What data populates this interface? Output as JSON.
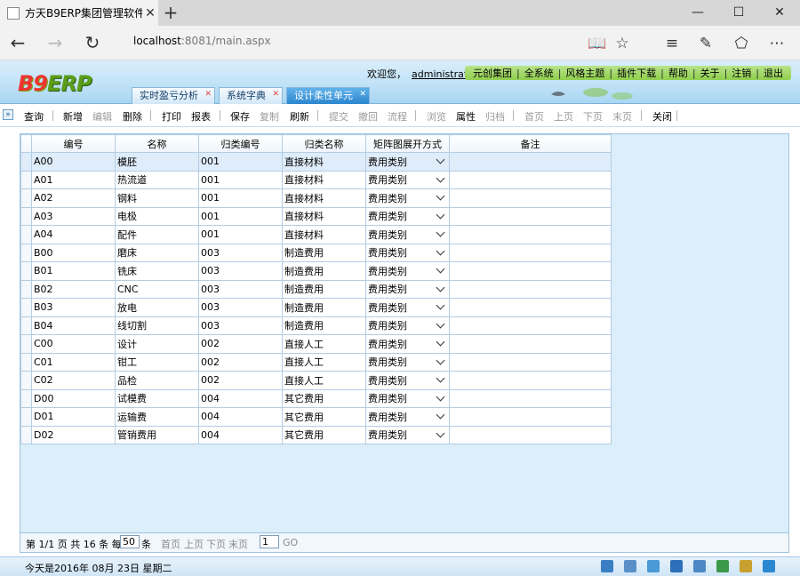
{
  "browser": {
    "tab_title": "方天B9ERP集团管理软件",
    "tab_close": "✕",
    "new_tab": "+",
    "minimize": "—",
    "maximize": "☐",
    "close": "✕",
    "url_host": "localhost",
    "url_rest": ":8081/main.aspx"
  },
  "app": {
    "logo_b9": "B9",
    "logo_erp": "ERP",
    "welcome": "欢迎您，",
    "user": "administrator",
    "top_menu": [
      "元创集团",
      "全系统",
      "风格主题",
      "插件下载",
      "帮助",
      "关于",
      "注销",
      "退出"
    ],
    "tabs": [
      {
        "label": "实时盈亏分析"
      },
      {
        "label": "系统字典"
      },
      {
        "label": "设计柔性单元",
        "active": true
      }
    ],
    "tab_close": "✕"
  },
  "toolbar": {
    "expand": "»",
    "groups": [
      [
        {
          "label": "查询",
          "enabled": true
        }
      ],
      [
        {
          "label": "新增",
          "enabled": true
        },
        {
          "label": "编辑",
          "enabled": false
        },
        {
          "label": "删除",
          "enabled": true
        }
      ],
      [
        {
          "label": "打印",
          "enabled": true
        },
        {
          "label": "报表",
          "enabled": true
        }
      ],
      [
        {
          "label": "保存",
          "enabled": true
        },
        {
          "label": "复制",
          "enabled": false
        },
        {
          "label": "刷新",
          "enabled": true
        }
      ],
      [
        {
          "label": "提交",
          "enabled": false
        },
        {
          "label": "撤回",
          "enabled": false
        },
        {
          "label": "流程",
          "enabled": false
        }
      ],
      [
        {
          "label": "浏览",
          "enabled": false
        },
        {
          "label": "属性",
          "enabled": true
        },
        {
          "label": "归档",
          "enabled": false
        }
      ],
      [
        {
          "label": "首页",
          "enabled": false
        },
        {
          "label": "上页",
          "enabled": false
        },
        {
          "label": "下页",
          "enabled": false
        },
        {
          "label": "末页",
          "enabled": false
        }
      ],
      [
        {
          "label": "关闭",
          "enabled": true
        }
      ]
    ]
  },
  "grid": {
    "columns": [
      "",
      "编号",
      "名称",
      "归类编号",
      "归类名称",
      "矩阵图展开方式",
      "备注"
    ],
    "rows": [
      [
        "A00",
        "模胚",
        "001",
        "直接材料",
        "费用类别",
        ""
      ],
      [
        "A01",
        "热流道",
        "001",
        "直接材料",
        "费用类别",
        ""
      ],
      [
        "A02",
        "钢料",
        "001",
        "直接材料",
        "费用类别",
        ""
      ],
      [
        "A03",
        "电极",
        "001",
        "直接材料",
        "费用类别",
        ""
      ],
      [
        "A04",
        "配件",
        "001",
        "直接材料",
        "费用类别",
        ""
      ],
      [
        "B00",
        "磨床",
        "003",
        "制造费用",
        "费用类别",
        ""
      ],
      [
        "B01",
        "铣床",
        "003",
        "制造费用",
        "费用类别",
        ""
      ],
      [
        "B02",
        "CNC",
        "003",
        "制造费用",
        "费用类别",
        ""
      ],
      [
        "B03",
        "放电",
        "003",
        "制造费用",
        "费用类别",
        ""
      ],
      [
        "B04",
        "线切割",
        "003",
        "制造费用",
        "费用类别",
        ""
      ],
      [
        "C00",
        "设计",
        "002",
        "直接人工",
        "费用类别",
        ""
      ],
      [
        "C01",
        "钳工",
        "002",
        "直接人工",
        "费用类别",
        ""
      ],
      [
        "C02",
        "品检",
        "002",
        "直接人工",
        "费用类别",
        ""
      ],
      [
        "D00",
        "试模费",
        "004",
        "其它费用",
        "费用类别",
        ""
      ],
      [
        "D01",
        "运输费",
        "004",
        "其它费用",
        "费用类别",
        ""
      ],
      [
        "D02",
        "管销费用",
        "004",
        "其它费用",
        "费用类别",
        ""
      ]
    ],
    "selected_row": 0
  },
  "pager": {
    "info": "第 1/1 页 共 16 条 每页",
    "page_size": "50",
    "unit": "条",
    "first": "首页",
    "prev": "上页",
    "next": "下页",
    "last": "末页",
    "page_input": "1",
    "go": "GO"
  },
  "status": {
    "today_text": "今天是2016年  08月  23日    星期二"
  }
}
